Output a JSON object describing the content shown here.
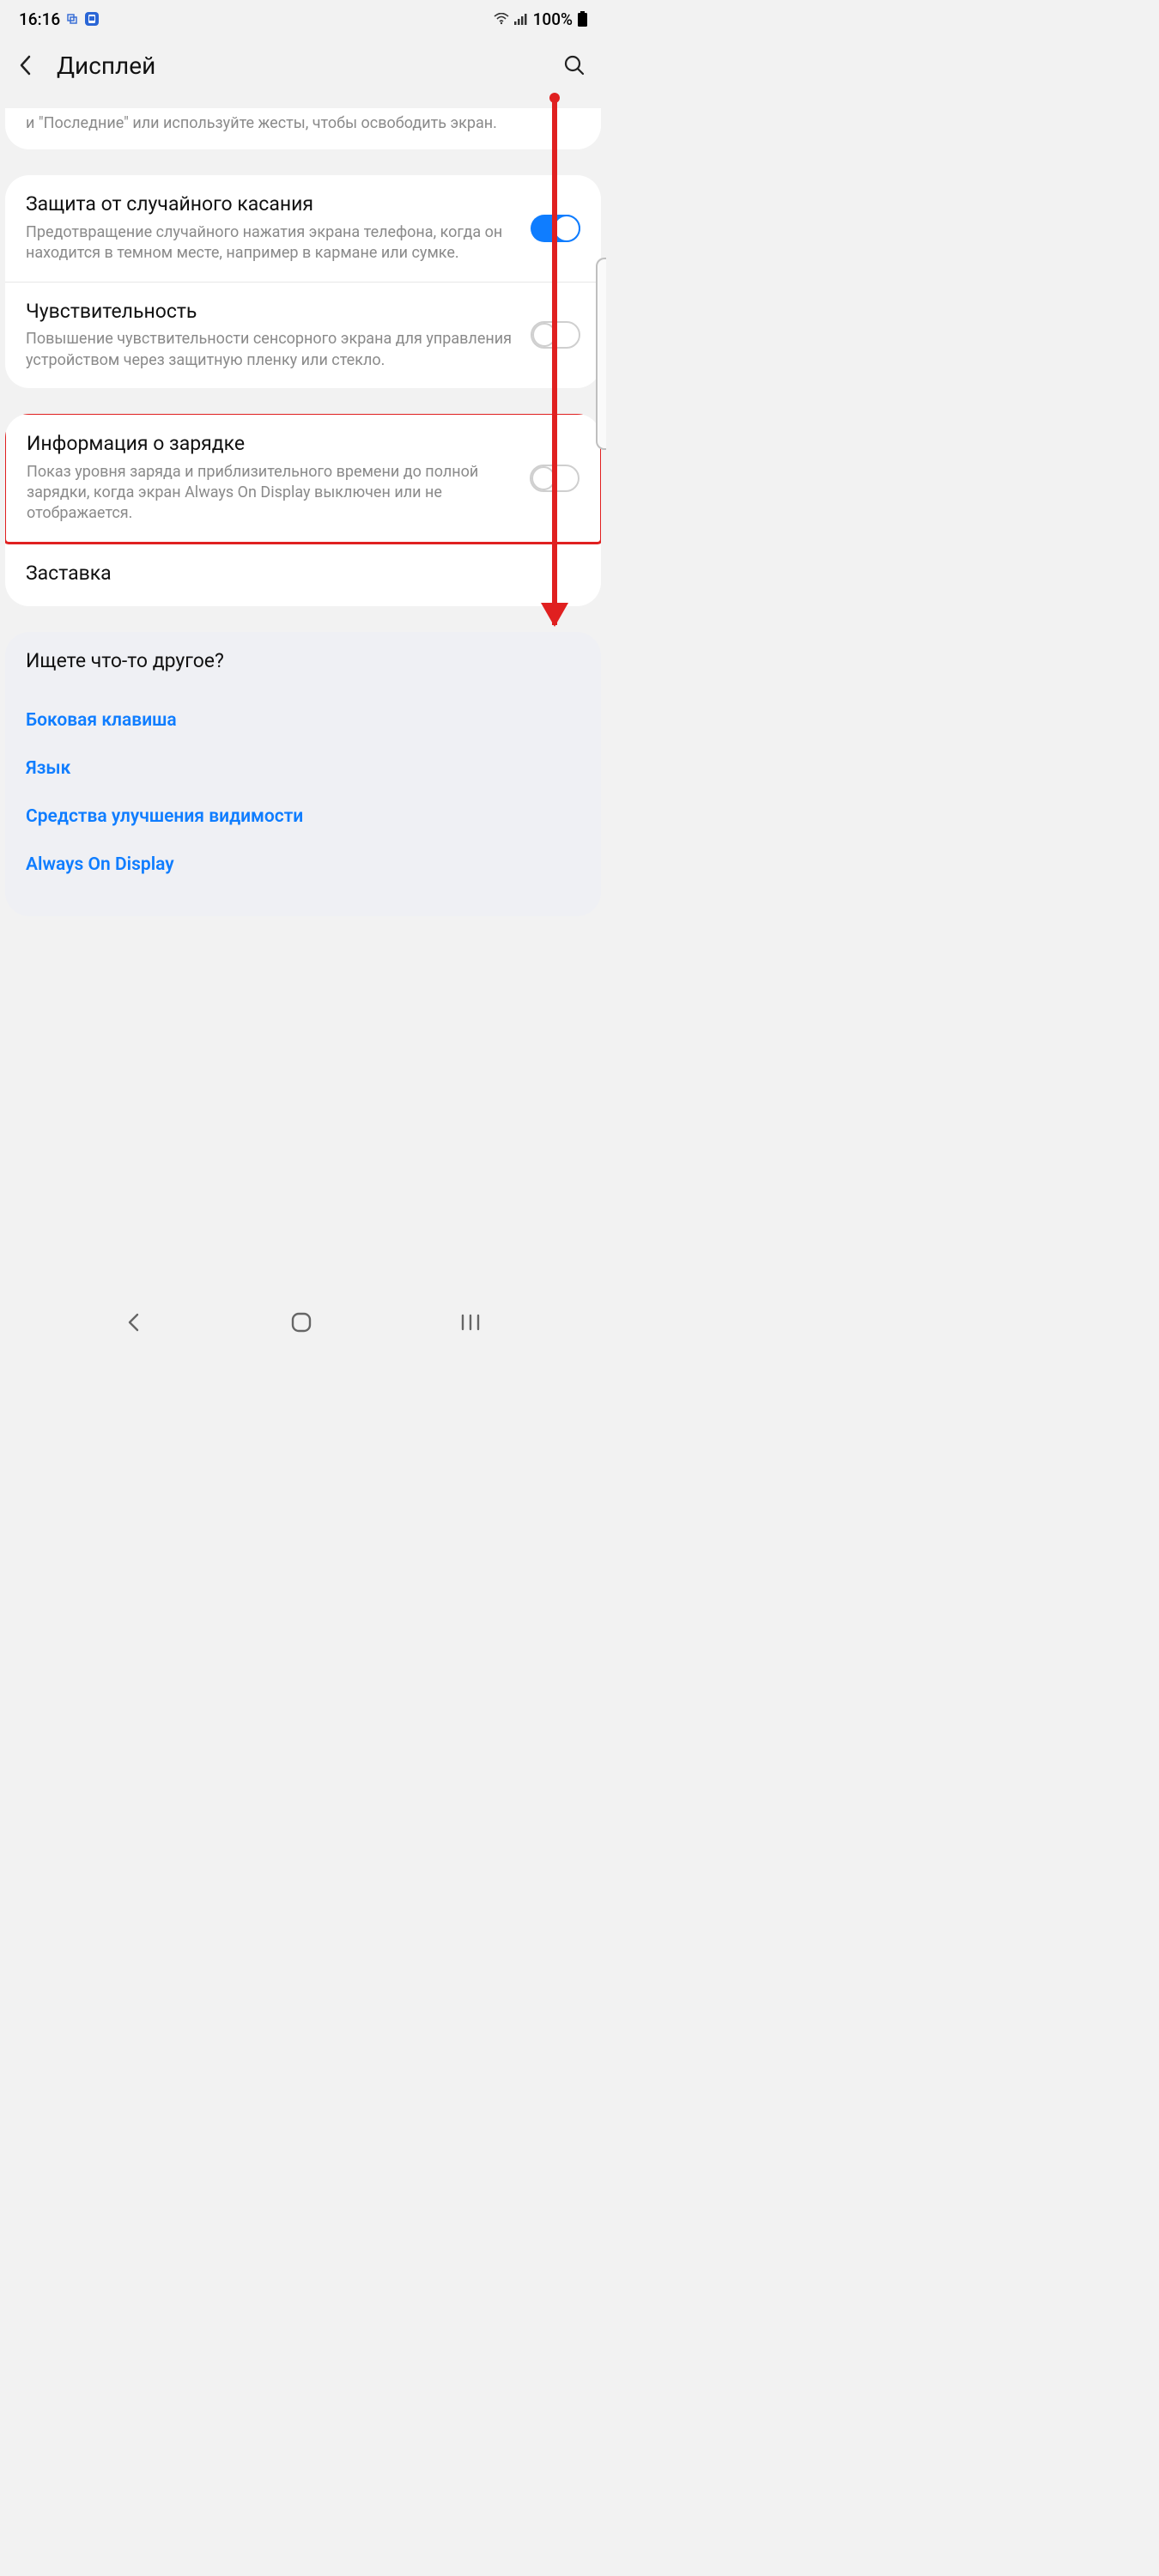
{
  "status": {
    "time": "16:16",
    "battery_pct": "100%"
  },
  "header": {
    "title": "Дисплей"
  },
  "truncated_card": {
    "text": "и \"Последние\" или используйте жесты, чтобы освободить экран."
  },
  "settings_group1": {
    "accidental_touch": {
      "title": "Защита от случайного касания",
      "desc": "Предотвращение случайного нажатия экрана телефона, когда он находится в темном месте, например в кармане или сумке.",
      "enabled": true
    },
    "sensitivity": {
      "title": "Чувствительность",
      "desc": "Повышение чувствительности сенсорного экрана для управления устройством через защитную пленку или стекло.",
      "enabled": false
    }
  },
  "settings_group2": {
    "charging_info": {
      "title": "Информация о зарядке",
      "desc": "Показ уровня заряда и приблизительного времени до полной зарядки, когда экран Always On Display выключен или не отображается.",
      "enabled": false
    },
    "screensaver": {
      "title": "Заставка"
    }
  },
  "related": {
    "heading": "Ищете что-то другое?",
    "links": [
      "Боковая клавиша",
      "Язык",
      "Средства улучшения видимости",
      "Always On Display"
    ]
  }
}
